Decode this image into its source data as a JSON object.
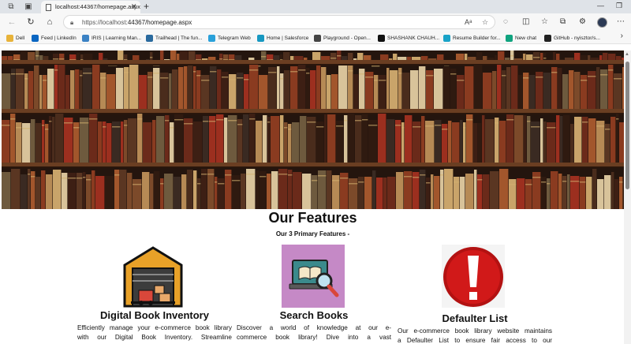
{
  "browser": {
    "tab_title": "localhost:44367/homepage.aspx",
    "url_host": "https://localhost",
    "url_rest": ":44367/homepage.aspx",
    "bookmarks": [
      {
        "label": "Dell",
        "icon": "folder-icon",
        "color": "#e8b33a"
      },
      {
        "label": "Feed | LinkedIn",
        "icon": "linkedin-icon",
        "color": "#0a66c2"
      },
      {
        "label": "IRIS | Learning Man...",
        "icon": "iris-icon",
        "color": "#3b82c4"
      },
      {
        "label": "Trailhead | The fun...",
        "icon": "trailhead-icon",
        "color": "#2a6a9e"
      },
      {
        "label": "Telegram Web",
        "icon": "telegram-icon",
        "color": "#2aa1da"
      },
      {
        "label": "Home | Salesforce",
        "icon": "salesforce-icon",
        "color": "#1798c1"
      },
      {
        "label": "Playground - Open...",
        "icon": "openai-icon",
        "color": "#444444"
      },
      {
        "label": "SHASHANK CHAUH...",
        "icon": "notion-icon",
        "color": "#111111"
      },
      {
        "label": "Resume Builder for...",
        "icon": "resume-icon",
        "color": "#19a3c8"
      },
      {
        "label": "New chat",
        "icon": "chat-icon",
        "color": "#10a37f"
      },
      {
        "label": "GitHub - nyisztor/s...",
        "icon": "github-icon",
        "color": "#222222"
      }
    ]
  },
  "page": {
    "title": "Our Features",
    "subtitle": "Our 3 Primary Features -",
    "features": [
      {
        "title": "Digital Book Inventory",
        "text_lines": [
          "Efficiently manage your e-commerce book library",
          "with our Digital Book Inventory. Streamline"
        ],
        "icon": "warehouse-icon"
      },
      {
        "title": "Search Books",
        "text_lines": [
          "Discover a world of knowledge at our e-",
          "commerce book library! Dive into a vast"
        ],
        "icon": "laptop-book-search-icon"
      },
      {
        "title": "Defaulter List",
        "text_lines": [
          "Our e-commerce book library website maintains",
          "a Defaulter List to ensure fair access to our"
        ],
        "icon": "exclamation-icon"
      }
    ]
  }
}
